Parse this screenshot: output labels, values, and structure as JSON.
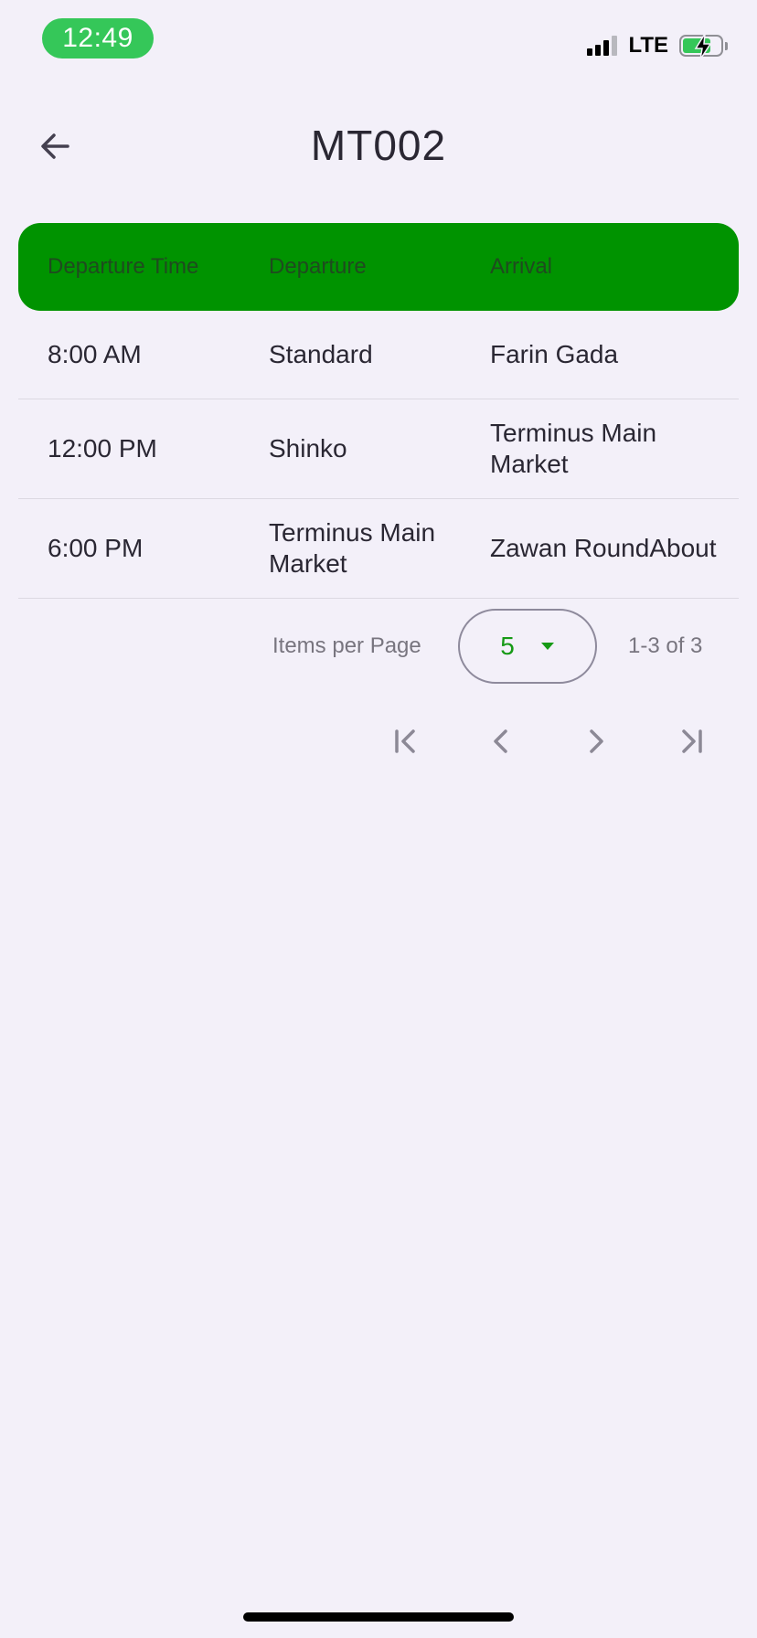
{
  "status_bar": {
    "time": "12:49",
    "network": "LTE",
    "icons": [
      "signal-icon",
      "battery-charging-icon"
    ]
  },
  "app_bar": {
    "title": "MT002",
    "back_icon": "arrow-left-icon"
  },
  "table": {
    "columns": [
      "Departure Time",
      "Departure",
      "Arrival"
    ],
    "rows": [
      [
        "8:00 AM",
        "Standard",
        "Farin Gada"
      ],
      [
        "12:00 PM",
        "Shinko",
        "Terminus Main Market"
      ],
      [
        "6:00 PM",
        "Terminus Main Market",
        "Zawan RoundAbout"
      ]
    ]
  },
  "pagination": {
    "items_per_page_label": "Items per Page",
    "page_size": "5",
    "range": "1-3 of 3",
    "icons": [
      "first-page-icon",
      "previous-page-icon",
      "next-page-icon",
      "last-page-icon"
    ]
  },
  "colors": {
    "header_bg": "#009300",
    "time_pill": "#35c759",
    "page_bg": "#f3f0f9",
    "accent_text": "#169a16"
  }
}
